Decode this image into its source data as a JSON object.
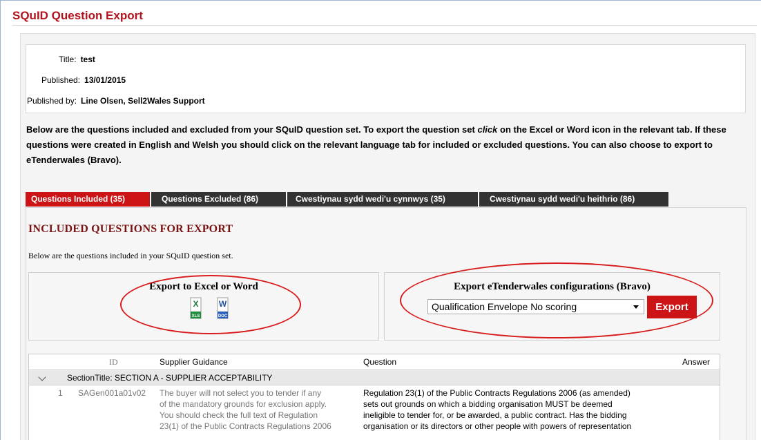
{
  "page": {
    "title": "SQuID Question Export"
  },
  "meta": {
    "title_label": "Title:",
    "title_value": "test",
    "published_label": "Published:",
    "published_value": "13/01/2015",
    "publisher_label": "Published by:",
    "publisher_value": "Line Olsen, Sell2Wales Support"
  },
  "intro": {
    "part1": "Below are the questions included and excluded from your SQuID question set. To export the question set ",
    "emph": "click",
    "part2": " on the Excel or Word icon in the relevant tab. If these questions were created in English and Welsh you should click on the relevant language tab for included or excluded questions. You can also choose to export to eTenderwales (Bravo)."
  },
  "tabs": [
    {
      "label": "Questions Included (35)",
      "active": true
    },
    {
      "label": "Questions Excluded (86)",
      "active": false
    },
    {
      "label": "Cwestiynau sydd wedi'u cynnwys (35)",
      "active": false
    },
    {
      "label": "Cwestiynau sydd wedi'u heithrio (86)",
      "active": false
    }
  ],
  "panel": {
    "heading": "INCLUDED QUESTIONS FOR EXPORT",
    "subheading": "Below are the questions included in your SQuID question set."
  },
  "export_office": {
    "title": "Export to Excel or Word",
    "excel_icon": "excel-xls-icon",
    "excel_letter": "X",
    "excel_tag": "XLS",
    "word_icon": "word-doc-icon",
    "word_letter": "W",
    "word_tag": "DOC"
  },
  "export_bravo": {
    "title": "Export eTenderwales configurations (Bravo)",
    "selected_option": "Qualification Envelope No scoring",
    "button_label": "Export"
  },
  "colors": {
    "brand_red": "#cc1416",
    "title_red": "#b3121c",
    "tab_dark": "#333333",
    "annotation_red": "#d81b1b"
  },
  "grid": {
    "columns": [
      "ID",
      "Supplier Guidance",
      "Question",
      "Answer"
    ],
    "group": "SectionTitle: SECTION A - SUPPLIER ACCEPTABILITY",
    "rows": [
      {
        "num": "1",
        "id": "SAGen001a01v02",
        "guidance": [
          "The buyer will not select you to tender if any",
          "of the mandatory grounds for exclusion apply.",
          "You should check the full text of Regulation",
          "23(1) of the Public Contracts Regulations 2006"
        ],
        "question": [
          "Regulation 23(1) of the Public Contracts Regulations 2006 (as amended)",
          "sets out grounds on which a bidding organisation MUST be deemed",
          "ineligible to tender for, or be awarded, a public contract. Has the bidding",
          "organisation or its directors or other people with powers of representation"
        ]
      }
    ]
  }
}
